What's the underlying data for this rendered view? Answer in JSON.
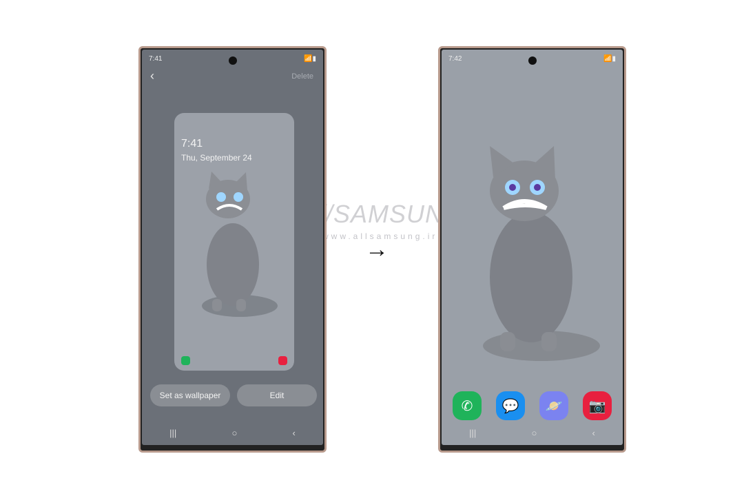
{
  "watermark": {
    "brand": "//SAMSUNG",
    "url": "www.allsamsung.ir"
  },
  "left_phone": {
    "status_time": "7:41",
    "status_icons": "wifi signal battery",
    "header": {
      "delete_label": "Delete"
    },
    "preview": {
      "lock_time": "7:41",
      "lock_date": "Thu, September 24"
    },
    "buttons": {
      "set_wallpaper": "Set as wallpaper",
      "edit": "Edit"
    }
  },
  "right_phone": {
    "status_time": "7:42",
    "dock": [
      {
        "name": "Phone",
        "icon": "phone-icon",
        "color": "#1fb35a"
      },
      {
        "name": "Messages",
        "icon": "chat-icon",
        "color": "#1a8ff0"
      },
      {
        "name": "Internet",
        "icon": "planet-icon",
        "color": "#7b83f0"
      },
      {
        "name": "Camera",
        "icon": "camera-icon",
        "color": "#e8203f"
      }
    ]
  },
  "nav": {
    "recents": "|||",
    "home": "○",
    "back": "‹"
  },
  "arrow": "→"
}
